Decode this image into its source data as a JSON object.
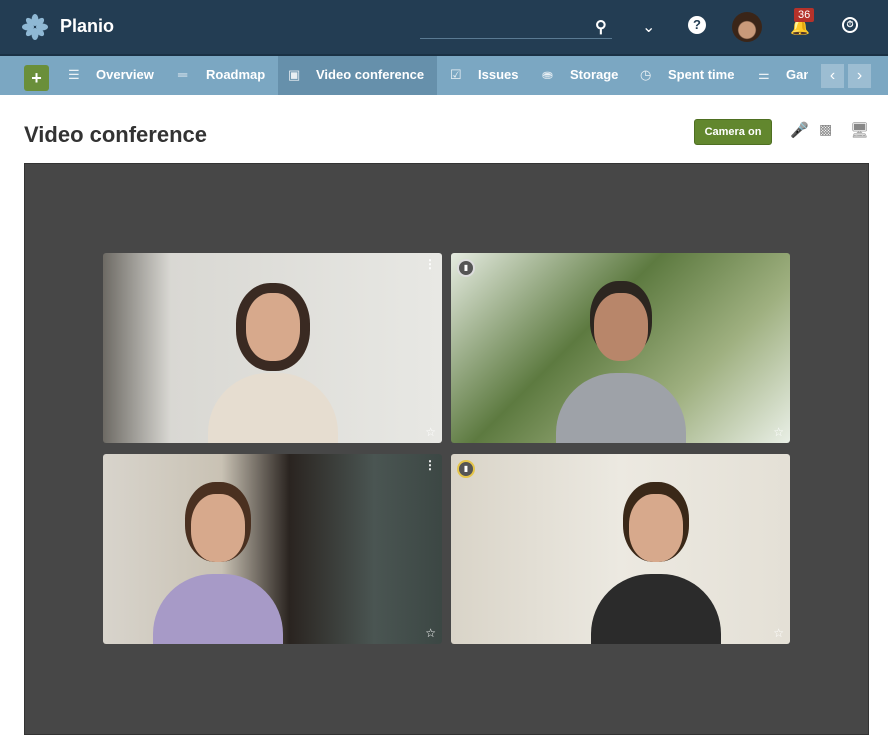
{
  "header": {
    "brand": "Planio",
    "notifications": "36",
    "icons": [
      "search-icon",
      "chevron-down-icon",
      "help-icon",
      "avatar",
      "bell-icon",
      "clock-icon"
    ]
  },
  "nav": {
    "tabs": [
      {
        "label": "Overview",
        "icon": "list-icon",
        "active": false
      },
      {
        "label": "Roadmap",
        "icon": "roadmap-icon",
        "active": false
      },
      {
        "label": "Video conference",
        "icon": "video-icon",
        "active": true
      },
      {
        "label": "Issues",
        "icon": "checkbox-icon",
        "active": false
      },
      {
        "label": "Storage",
        "icon": "database-icon",
        "active": false
      },
      {
        "label": "Spent time",
        "icon": "clock-icon",
        "active": false
      },
      {
        "label": "Gantt",
        "icon": "gantt-icon",
        "active": false
      }
    ]
  },
  "page": {
    "title": "Video conference",
    "camera_button": "Camera on"
  },
  "colors": {
    "header": "#233d53",
    "nav": "#7ba7c2",
    "nav_active": "#6690ab",
    "accent_green": "#62872e",
    "stage": "#474747",
    "badge": "#b5322a"
  }
}
